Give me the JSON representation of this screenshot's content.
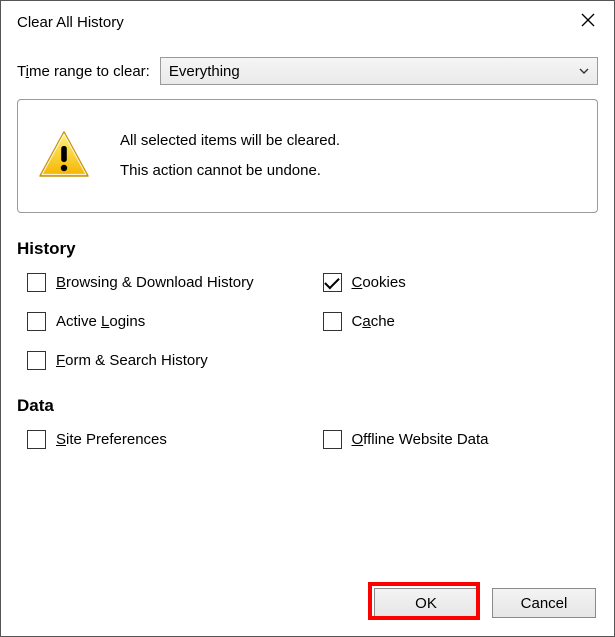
{
  "title": "Clear All History",
  "range": {
    "label_pre": "T",
    "label_ul": "i",
    "label_post": "me range to clear:",
    "selected": "Everything"
  },
  "warning": {
    "line1": "All selected items will be cleared.",
    "line2": "This action cannot be undone."
  },
  "sections": {
    "history": {
      "heading": "History",
      "items": [
        {
          "pre": "",
          "ul": "B",
          "post": "rowsing & Download History",
          "checked": false
        },
        {
          "pre": "",
          "ul": "C",
          "post": "ookies",
          "checked": true
        },
        {
          "pre": "Active ",
          "ul": "L",
          "post": "ogins",
          "checked": false
        },
        {
          "pre": "C",
          "ul": "a",
          "post": "che",
          "checked": false
        },
        {
          "pre": "",
          "ul": "F",
          "post": "orm & Search History",
          "checked": false
        }
      ]
    },
    "data": {
      "heading": "Data",
      "items": [
        {
          "pre": "",
          "ul": "S",
          "post": "ite Preferences",
          "checked": false
        },
        {
          "pre": "",
          "ul": "O",
          "post": "ffline Website Data",
          "checked": false
        }
      ]
    }
  },
  "buttons": {
    "ok": "OK",
    "cancel": "Cancel"
  }
}
